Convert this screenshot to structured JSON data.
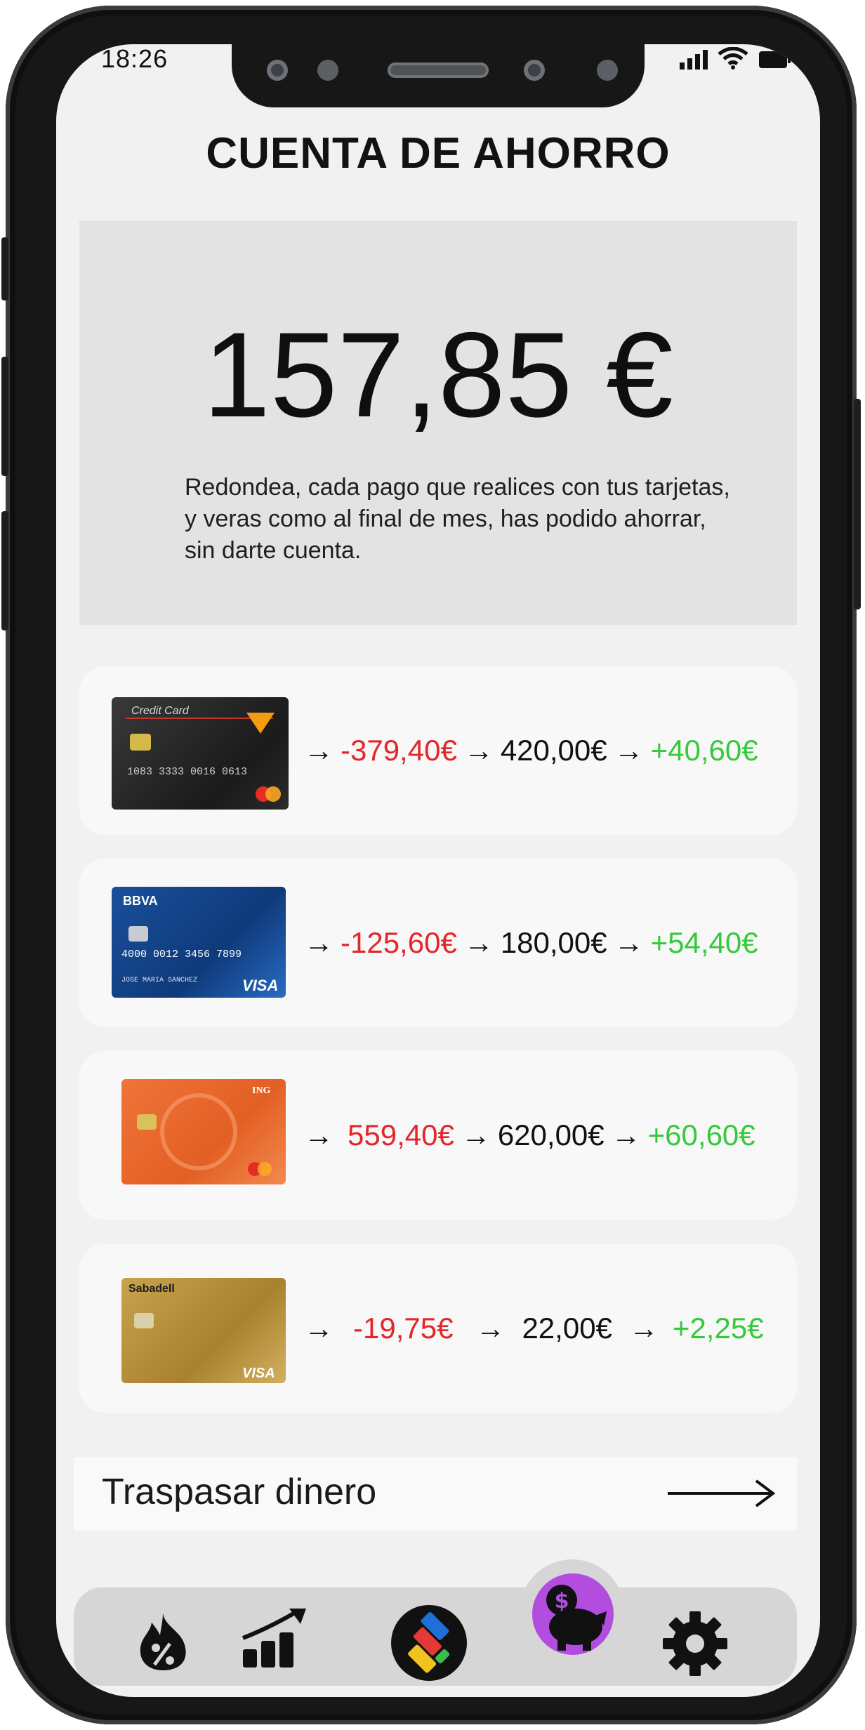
{
  "status_bar": {
    "time": "18:26"
  },
  "header": {
    "title": "CUENTA DE AHORRO"
  },
  "balance": {
    "amount": "157,85 €",
    "description": "Redondea, cada pago que realices con tus tarjetas, y veras como al final de mes, has podido ahorrar, sin darte cuenta."
  },
  "cards": [
    {
      "name": "Credit Card",
      "number": "1083 3333 0016 0613",
      "spent": "-379,40€",
      "rounded": "420,00€",
      "saved": "+40,60€"
    },
    {
      "name": "BBVA",
      "number": "4000 0012 3456 7899",
      "holder": "JOSE MARIA SANCHEZ",
      "spent": "-125,60€",
      "rounded": "180,00€",
      "saved": "+54,40€"
    },
    {
      "name": "ING",
      "spent": "559,40€",
      "rounded": "620,00€",
      "saved": "+60,60€"
    },
    {
      "name": "Sabadell",
      "spent": "-19,75€",
      "rounded": "22,00€",
      "saved": "+2,25€"
    }
  ],
  "transfer": {
    "label": "Traspasar dinero"
  },
  "arrow_glyph": "→",
  "colors": {
    "negative": "#e3262a",
    "positive": "#36c93c",
    "accent": "#b24de0",
    "nav_bg": "#d6d6d6"
  },
  "nav": {
    "items": [
      "fire-percent-icon",
      "chart-growth-icon",
      "cards-app-icon",
      "piggy-bank-icon",
      "gear-icon"
    ],
    "active": "piggy-bank-icon"
  }
}
